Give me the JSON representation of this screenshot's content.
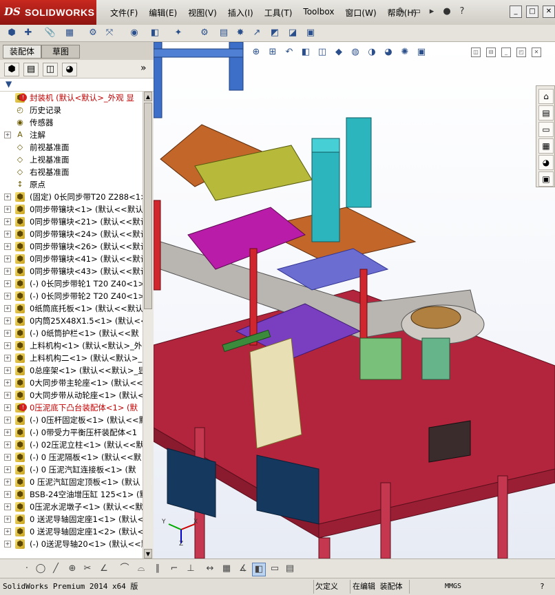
{
  "app": {
    "logo_ds": "DS",
    "logo_name": "SOLIDWORKS"
  },
  "menu": [
    "文件(F)",
    "编辑(E)",
    "视图(V)",
    "插入(I)",
    "工具(T)",
    "Toolbox",
    "窗口(W)",
    "帮助(H)"
  ],
  "panel": {
    "tab_assembly": "装配体",
    "tab_sketch": "草图",
    "expand_glyph": "»"
  },
  "tree": [
    {
      "label": "封装机  (默认<默认>_外观 显",
      "red": true,
      "plus": false,
      "icon": "assembly-root-icon",
      "error": true
    },
    {
      "label": "历史记录",
      "plus": false,
      "icon": "history-icon"
    },
    {
      "label": "传感器",
      "plus": false,
      "icon": "sensor-icon"
    },
    {
      "label": "注解",
      "plus": true,
      "icon": "annotation-icon"
    },
    {
      "label": "前视基准面",
      "plus": false,
      "icon": "plane-icon"
    },
    {
      "label": "上视基准面",
      "plus": false,
      "icon": "plane-icon"
    },
    {
      "label": "右视基准面",
      "plus": false,
      "icon": "plane-icon"
    },
    {
      "label": "原点",
      "plus": false,
      "icon": "origin-icon"
    },
    {
      "label": "(固定) 0长同步带T20 Z288<1>",
      "plus": true,
      "icon": "component-icon"
    },
    {
      "label": "0同步带镶块<1> (默认<<默认>",
      "plus": true,
      "icon": "component-icon"
    },
    {
      "label": "0同步带镶块<21> (默认<<默认",
      "plus": true,
      "icon": "component-icon"
    },
    {
      "label": "0同步带镶块<24> (默认<<默认",
      "plus": true,
      "icon": "component-icon"
    },
    {
      "label": "0同步带镶块<26> (默认<<默认",
      "plus": true,
      "icon": "component-icon"
    },
    {
      "label": "0同步带镶块<41> (默认<<默认",
      "plus": true,
      "icon": "component-icon"
    },
    {
      "label": "0同步带镶块<43> (默认<<默认",
      "plus": true,
      "icon": "component-icon"
    },
    {
      "label": "(-) 0长同步带轮1 T20 Z40<1>",
      "plus": true,
      "icon": "component-icon"
    },
    {
      "label": "(-) 0长同步带轮2 T20 Z40<1>",
      "plus": true,
      "icon": "component-icon"
    },
    {
      "label": "0纸筒底托板<1> (默认<<默认>",
      "plus": true,
      "icon": "component-icon"
    },
    {
      "label": "0内筒25X48X1.5<1> (默认<<默",
      "plus": true,
      "icon": "component-icon"
    },
    {
      "label": "(-) 0纸筒护栏<1> (默认<<默",
      "plus": true,
      "icon": "component-icon"
    },
    {
      "label": "上料机构<1> (默认<默认>_外",
      "plus": true,
      "icon": "component-icon"
    },
    {
      "label": "上料机构二<1> (默认<默认>_",
      "plus": true,
      "icon": "component-icon"
    },
    {
      "label": "0总座架<1> (默认<<默认>_显示",
      "plus": true,
      "icon": "component-icon"
    },
    {
      "label": "0大同步带主轮座<1> (默认<<默",
      "plus": true,
      "icon": "component-icon"
    },
    {
      "label": "0大同步带从动轮座<1> (默认<<",
      "plus": true,
      "icon": "component-icon"
    },
    {
      "label": "0压泥底下凸台装配体<1> (默",
      "plus": true,
      "icon": "component-icon",
      "red": true,
      "error": true
    },
    {
      "label": "(-) 0压杆固定板<1> (默认<<默",
      "plus": true,
      "icon": "component-icon"
    },
    {
      "label": "(-) 0带受力平衡压杆装配体<1",
      "plus": true,
      "icon": "component-icon"
    },
    {
      "label": "(-) 02压泥立柱<1> (默认<<默认",
      "plus": true,
      "icon": "component-icon"
    },
    {
      "label": "(-) 0 压泥隔板<1> (默认<<默",
      "plus": true,
      "icon": "component-icon"
    },
    {
      "label": "(-) 0 压泥汽缸连接板<1> (默",
      "plus": true,
      "icon": "component-icon"
    },
    {
      "label": "0 压泥汽缸固定顶板<1> (默认",
      "plus": true,
      "icon": "component-icon"
    },
    {
      "label": "BSB-24空油增压缸 125<1> (默",
      "plus": true,
      "icon": "component-icon"
    },
    {
      "label": "0压泥水泥墩子<1> (默认<<默认",
      "plus": true,
      "icon": "component-icon"
    },
    {
      "label": "0 送泥导轴固定座1<1> (默认<",
      "plus": true,
      "icon": "component-icon"
    },
    {
      "label": "0 送泥导轴固定座1<2> (默认<",
      "plus": true,
      "icon": "component-icon"
    },
    {
      "label": "(-) 0送泥导轴20<1> (默认<<默",
      "plus": true,
      "icon": "component-icon"
    }
  ],
  "status": {
    "product": "SolidWorks Premium 2014 x64 版",
    "definition": "欠定义",
    "mode": "在编辑 装配体",
    "units": "MMGS",
    "help": "?"
  },
  "triad": {
    "x": "X",
    "y": "Y",
    "z": "Z"
  }
}
